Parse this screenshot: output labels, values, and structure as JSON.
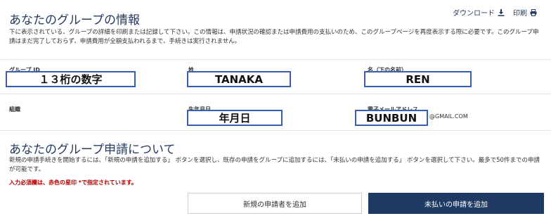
{
  "header": {
    "title": "あなたのグループの情報",
    "download_label": "ダウンロード",
    "print_label": "印刷",
    "description": "下に表示されている、グループの詳細を印刷または記録して下さい。この情報は、申請状況の確認または申請費用の支払いのため、このグループページを再度表示する際に必要です。このグループ申請はまだ完了しておらず、申請費用が全額支払われるまで、手続きは実行されません。"
  },
  "group": {
    "group_id_label": "グループ ID",
    "group_id_value": "１３桁の数字",
    "surname_label": "姓",
    "surname_value": "TANAKA",
    "given_name_label": "名（下の名前）",
    "given_name_value": "REN",
    "organization_label": "組織",
    "dob_label": "生年月日",
    "dob_value": "年月日",
    "email_label": "電子メールアドレス",
    "email_value": "BUNBUN",
    "email_domain": "@GMAIL.COM"
  },
  "application": {
    "title": "あなたのグループ申請について",
    "description": "新規の申請手続きを開始するには、「新規の申請を追加する」 ボタンを選択し、既存の申請をグループに追加するには、「未払いの申請を追加する」 ボタンを選択して下さい。最多で50件までの申請が可能です。",
    "required_note": "入力必須欄は、赤色の星印 *で指定されています。",
    "add_applicant_label": "新規の申請者を追加",
    "add_unpaid_label": "未払いの申請を追加"
  },
  "colors": {
    "heading": "#243a5e",
    "box_border": "#3a5fb0",
    "primary_button": "#1f3a64",
    "required": "#b30000"
  }
}
